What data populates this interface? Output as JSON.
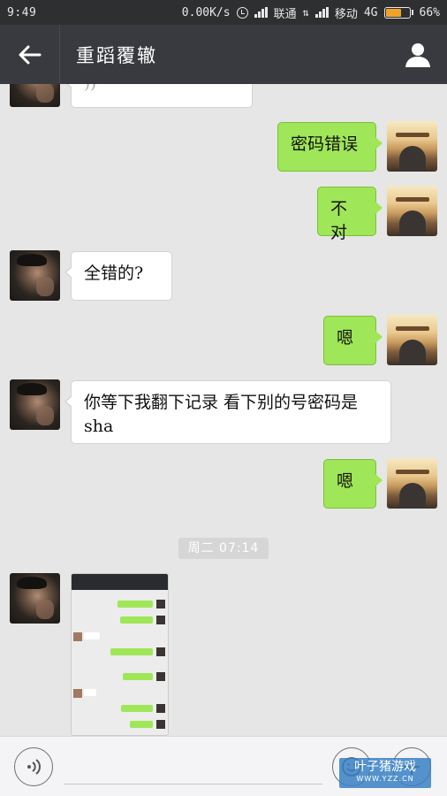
{
  "status_bar": {
    "time": "9:49",
    "speed": "0.00K/s",
    "carrier1": "联通",
    "carrier2": "移动",
    "network": "4G",
    "battery": "66%",
    "battery_level": 0.66,
    "battery_color": "#f0a32a"
  },
  "header": {
    "title": "重蹈覆辙",
    "back_icon": "arrow-left-icon",
    "profile_icon": "person-icon"
  },
  "messages": [
    {
      "side": "left",
      "text": "",
      "type": "voice-partial"
    },
    {
      "side": "right",
      "text": "密码错误"
    },
    {
      "side": "right",
      "text": "不对"
    },
    {
      "side": "left",
      "text": "全错的?"
    },
    {
      "side": "right",
      "text": "嗯"
    },
    {
      "side": "left",
      "text": "你等下我翻下记录 看下别的号密码是sha"
    },
    {
      "side": "right",
      "text": "嗯"
    },
    {
      "side": "left",
      "type": "image",
      "text": ""
    }
  ],
  "time_separator": "周二 07:14",
  "input_bar": {
    "placeholder": "",
    "voice_icon": "voice-icon",
    "emoji_icon": "emoji-icon",
    "more_icon": "plus-icon"
  },
  "watermark": {
    "line1": "叶子猪游戏",
    "line2": "WWW.YZZ.CN"
  },
  "colors": {
    "header_bg": "#393a3f",
    "bubble_right": "#9fe658",
    "bubble_left": "#ffffff",
    "chat_bg": "#e6e6e6"
  }
}
